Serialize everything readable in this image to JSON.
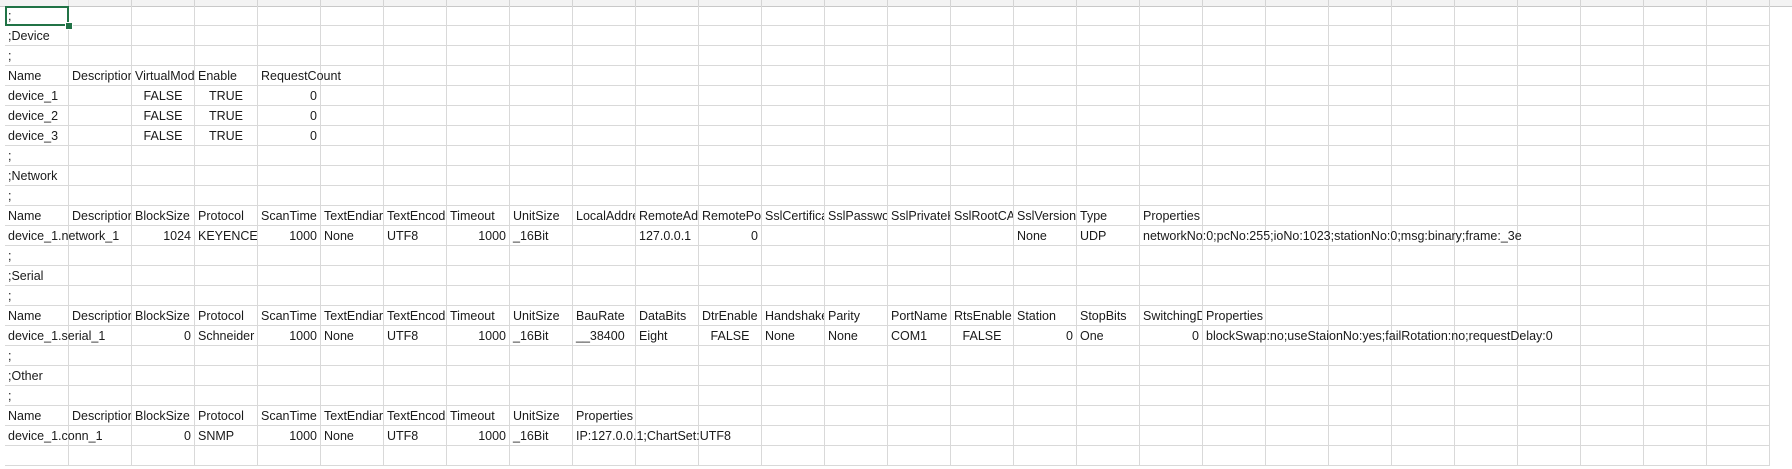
{
  "sheet": {
    "rows": [
      [
        ";"
      ],
      [
        ";Device"
      ],
      [
        ";"
      ],
      [
        "Name",
        "Description",
        "VirtualMode",
        "Enable",
        "RequestCount"
      ],
      [
        "device_1",
        "",
        "FALSE",
        "TRUE",
        "0"
      ],
      [
        "device_2",
        "",
        "FALSE",
        "TRUE",
        "0"
      ],
      [
        "device_3",
        "",
        "FALSE",
        "TRUE",
        "0"
      ],
      [
        ";"
      ],
      [
        ";Network"
      ],
      [
        ";"
      ],
      [
        "Name",
        "Description",
        "BlockSize",
        "Protocol",
        "ScanTime",
        "TextEndian",
        "TextEncoding",
        "Timeout",
        "UnitSize",
        "LocalAddress",
        "RemoteAddress",
        "RemotePort",
        "SslCertificate",
        "SslPassword",
        "SslPrivateKey",
        "SslRootCA",
        "SslVersion",
        "Type",
        "Properties"
      ],
      [
        "device_1.network_1",
        "",
        "1024",
        "KEYENCE Ethernet",
        "1000",
        "None",
        "UTF8",
        "1000",
        "_16Bit",
        "",
        "127.0.0.1",
        "0",
        "",
        "",
        "",
        "",
        "None",
        "UDP",
        "networkNo:0;pcNo:255;ioNo:1023;stationNo:0;msg:binary;frame:_3e"
      ],
      [
        ";"
      ],
      [
        ";Serial"
      ],
      [
        ";"
      ],
      [
        "Name",
        "Description",
        "BlockSize",
        "Protocol",
        "ScanTime",
        "TextEndian",
        "TextEncoding",
        "Timeout",
        "UnitSize",
        "BauRate",
        "DataBits",
        "DtrEnable",
        "Handshake",
        "Parity",
        "PortName",
        "RtsEnable",
        "Station",
        "StopBits",
        "SwitchingDelay",
        "Properties"
      ],
      [
        "device_1.serial_1",
        "",
        "0",
        "Schneider Modbus",
        "1000",
        "None",
        "UTF8",
        "1000",
        "_16Bit",
        "__38400",
        "Eight",
        "FALSE",
        "None",
        "None",
        "COM1",
        "FALSE",
        "0",
        "One",
        "0",
        "blockSwap:no;useStaionNo:yes;failRotation:no;requestDelay:0"
      ],
      [
        ";"
      ],
      [
        ";Other"
      ],
      [
        ";"
      ],
      [
        "Name",
        "Description",
        "BlockSize",
        "Protocol",
        "ScanTime",
        "TextEndian",
        "TextEncoding",
        "Timeout",
        "UnitSize",
        "Properties"
      ],
      [
        "device_1.conn_1",
        "",
        "0",
        "SNMP",
        "1000",
        "None",
        "UTF8",
        "1000",
        "_16Bit",
        "IP:127.0.0.1;ChartSet:UTF8"
      ],
      []
    ],
    "selected_cell": "A1"
  }
}
